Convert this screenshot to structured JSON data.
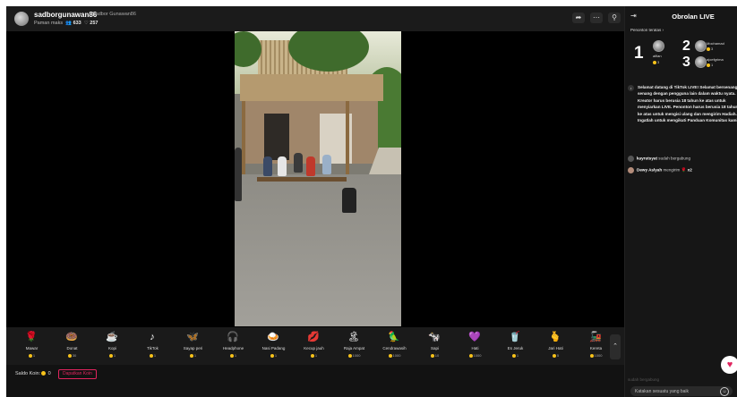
{
  "header": {
    "username": "sadborgunawan86",
    "display_name": "Sadbor Gunawan86",
    "popular_label": "Paman maks",
    "viewers": "633",
    "likes": "257",
    "share_icon": "share-arrow-icon",
    "more_icon": "more-dots-icon",
    "profile_icon": "user-icon"
  },
  "gifts": [
    {
      "name": "Mawar",
      "cost": "1",
      "icon": "rose-icon",
      "glyph": "🌹"
    },
    {
      "name": "Donat",
      "cost": "30",
      "icon": "donut-icon",
      "glyph": "🍩"
    },
    {
      "name": "Kopi",
      "cost": "1",
      "icon": "coffee-icon",
      "glyph": "☕"
    },
    {
      "name": "TikTok",
      "cost": "1",
      "icon": "tiktok-icon",
      "glyph": "♪"
    },
    {
      "name": "Sayap peri",
      "cost": "1",
      "icon": "fairy-wings-icon",
      "glyph": "🦋"
    },
    {
      "name": "Headphone",
      "cost": "1",
      "icon": "headphone-icon",
      "glyph": "🎧"
    },
    {
      "name": "Nasi Padang",
      "cost": "1",
      "icon": "rice-dish-icon",
      "glyph": "🍛"
    },
    {
      "name": "Kecup jauh",
      "cost": "1",
      "icon": "kiss-icon",
      "glyph": "💋"
    },
    {
      "name": "Raja Ampat",
      "cost": "1000",
      "icon": "island-icon",
      "glyph": "🏝"
    },
    {
      "name": "Cendrawasih",
      "cost": "1000",
      "icon": "bird-icon",
      "glyph": "🦜"
    },
    {
      "name": "Sapi",
      "cost": "10",
      "icon": "cow-icon",
      "glyph": "🐄"
    },
    {
      "name": "Hati",
      "cost": "1000",
      "icon": "heart-icon",
      "glyph": "💜"
    },
    {
      "name": "Es Jeruk",
      "cost": "1",
      "icon": "juice-icon",
      "glyph": "🥤"
    },
    {
      "name": "Jari Hati",
      "cost": "5",
      "icon": "finger-heart-icon",
      "glyph": "🫰"
    },
    {
      "name": "Kereta",
      "cost": "1000",
      "icon": "train-icon",
      "glyph": "🚂"
    }
  ],
  "footer": {
    "balance_label": "Saldo Koin:",
    "balance_value": "0",
    "get_coins": "Dapatkan Koin"
  },
  "chat": {
    "title": "Obrolan LIVE",
    "top_viewers_label": "Penonton teratas",
    "top": [
      {
        "rank": "1",
        "name": "alfian",
        "score": "3"
      },
      {
        "rank": "2",
        "name": "Mochamad",
        "score": "3"
      },
      {
        "rank": "3",
        "name": "ajoefgrima",
        "score": "1"
      }
    ],
    "welcome": "Selamat datang di TikTok LIVE! Selamat bersenang-senang dengan pengguna lain dalam waktu nyata. Kreator harus berusia 18 tahun ke atas untuk menyiarkan LIVE. Penonton harus berusia 18 tahun ke atas untuk mengisi ulang dan mengirim Hadiah. Ingatlah untuk mengikuti Panduan Komunitas kami.",
    "events": [
      {
        "user": "kayrutsyat",
        "text": "sudah bergabung"
      },
      {
        "user": "Dewy Aslyah",
        "text": "mengirim",
        "suffix": "x2"
      }
    ],
    "faint_text": "sudah bergabung",
    "input_placeholder": "Katakan sesuatu yang baik"
  }
}
